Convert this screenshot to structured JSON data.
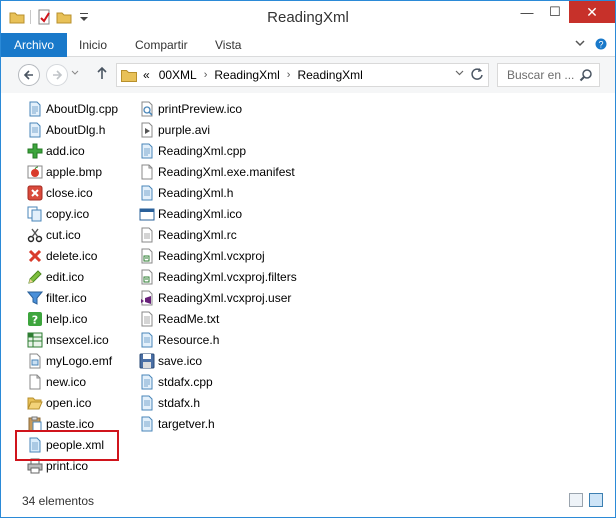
{
  "window": {
    "title": "ReadingXml",
    "minimize_glyph": "—",
    "maximize_glyph": "☐",
    "close_glyph": "✕"
  },
  "ribbon": {
    "file_tab": "Archivo",
    "tabs": [
      "Inicio",
      "Compartir",
      "Vista"
    ]
  },
  "address": {
    "prefix": "«",
    "crumbs": [
      "00XML",
      "ReadingXml",
      "ReadingXml"
    ],
    "search_placeholder": "Buscar en ..."
  },
  "files": {
    "column1": [
      {
        "name": "AboutDlg.cpp",
        "icon": "cpp-file-icon"
      },
      {
        "name": "AboutDlg.h",
        "icon": "header-file-icon"
      },
      {
        "name": "add.ico",
        "icon": "add-icon"
      },
      {
        "name": "apple.bmp",
        "icon": "bitmap-icon"
      },
      {
        "name": "close.ico",
        "icon": "close-ico-icon"
      },
      {
        "name": "copy.ico",
        "icon": "copy-icon"
      },
      {
        "name": "cut.ico",
        "icon": "scissors-icon"
      },
      {
        "name": "delete.ico",
        "icon": "delete-icon"
      },
      {
        "name": "edit.ico",
        "icon": "pencil-icon"
      },
      {
        "name": "filter.ico",
        "icon": "filter-icon"
      },
      {
        "name": "help.ico",
        "icon": "help-icon"
      },
      {
        "name": "msexcel.ico",
        "icon": "excel-icon"
      },
      {
        "name": "myLogo.emf",
        "icon": "emf-file-icon"
      },
      {
        "name": "new.ico",
        "icon": "new-file-icon"
      },
      {
        "name": "open.ico",
        "icon": "open-folder-icon"
      },
      {
        "name": "paste.ico",
        "icon": "paste-icon"
      },
      {
        "name": "people.xml",
        "icon": "xml-file-icon"
      },
      {
        "name": "print.ico",
        "icon": "printer-icon"
      }
    ],
    "column2": [
      {
        "name": "printPreview.ico",
        "icon": "print-preview-icon"
      },
      {
        "name": "purple.avi",
        "icon": "video-file-icon"
      },
      {
        "name": "ReadingXml.cpp",
        "icon": "cpp-file-icon"
      },
      {
        "name": "ReadingXml.exe.manifest",
        "icon": "manifest-file-icon"
      },
      {
        "name": "ReadingXml.h",
        "icon": "header-file-icon"
      },
      {
        "name": "ReadingXml.ico",
        "icon": "window-ico-icon"
      },
      {
        "name": "ReadingXml.rc",
        "icon": "rc-file-icon"
      },
      {
        "name": "ReadingXml.vcxproj",
        "icon": "vcxproj-file-icon"
      },
      {
        "name": "ReadingXml.vcxproj.filters",
        "icon": "filters-file-icon"
      },
      {
        "name": "ReadingXml.vcxproj.user",
        "icon": "vs-user-file-icon"
      },
      {
        "name": "ReadMe.txt",
        "icon": "text-file-icon"
      },
      {
        "name": "Resource.h",
        "icon": "header-file-icon"
      },
      {
        "name": "save.ico",
        "icon": "save-icon"
      },
      {
        "name": "stdafx.cpp",
        "icon": "cpp-file-icon"
      },
      {
        "name": "stdafx.h",
        "icon": "header-file-icon"
      },
      {
        "name": "targetver.h",
        "icon": "header-file-icon"
      }
    ]
  },
  "status": {
    "item_count": "34 elementos"
  },
  "colors": {
    "accent": "#1979ca",
    "highlight_border": "#d0141c",
    "close_button": "#c7312a"
  }
}
